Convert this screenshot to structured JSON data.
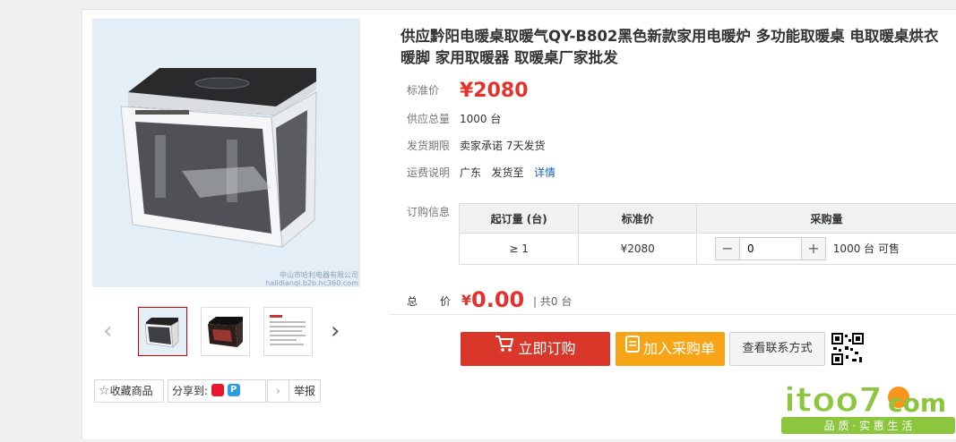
{
  "product": {
    "title": "供应黔阳电暖桌取暖气QY-B802黑色新款家用电暖炉 多功能取暖桌 电取暖桌烘衣暖脚 家用取暖器 取暖桌厂家批发",
    "image_caption_line1": "中山市哈利电器有限公司",
    "image_caption_line2": "halidianqi.b2b.hc360.com"
  },
  "info": {
    "price_label": "标准价",
    "price": "¥2080",
    "supply_label": "供应总量",
    "supply_value": "1000 台",
    "delivery_label": "发货期限",
    "delivery_value": "卖家承诺 7天发货",
    "shipping_label": "运费说明",
    "shipping_from": "广东",
    "shipping_to": "发货至",
    "shipping_detail": "详情"
  },
  "order": {
    "label": "订购信息",
    "headers": [
      "起订量 (台)",
      "标准价",
      "采购量"
    ],
    "min_qty": "≥ 1",
    "unit_price": "¥2080",
    "qty_value": "0",
    "minus": "−",
    "plus": "+",
    "available": "1000 台 可售"
  },
  "total": {
    "label_1": "总",
    "label_2": "价",
    "currency": "¥",
    "amount": "0.00",
    "count": "| 共0 台"
  },
  "buttons": {
    "buy": "立即订购",
    "cart": "加入采购单",
    "contact": "查看联系方式"
  },
  "actions": {
    "favorite": "收藏商品",
    "share": "分享到:",
    "report": "举报"
  },
  "gallery": {
    "prev": "‹",
    "next": "›"
  },
  "logo": {
    "brand": "itoo7",
    "suffix": "com",
    "slogan": "品 质 · 实 惠 生 活"
  },
  "colors": {
    "price_red": "#e4322b",
    "buy_button": "#d8372a",
    "cart_button": "#f7a516",
    "link_blue": "#1a62b5",
    "logo_green": "#8cc63f"
  }
}
